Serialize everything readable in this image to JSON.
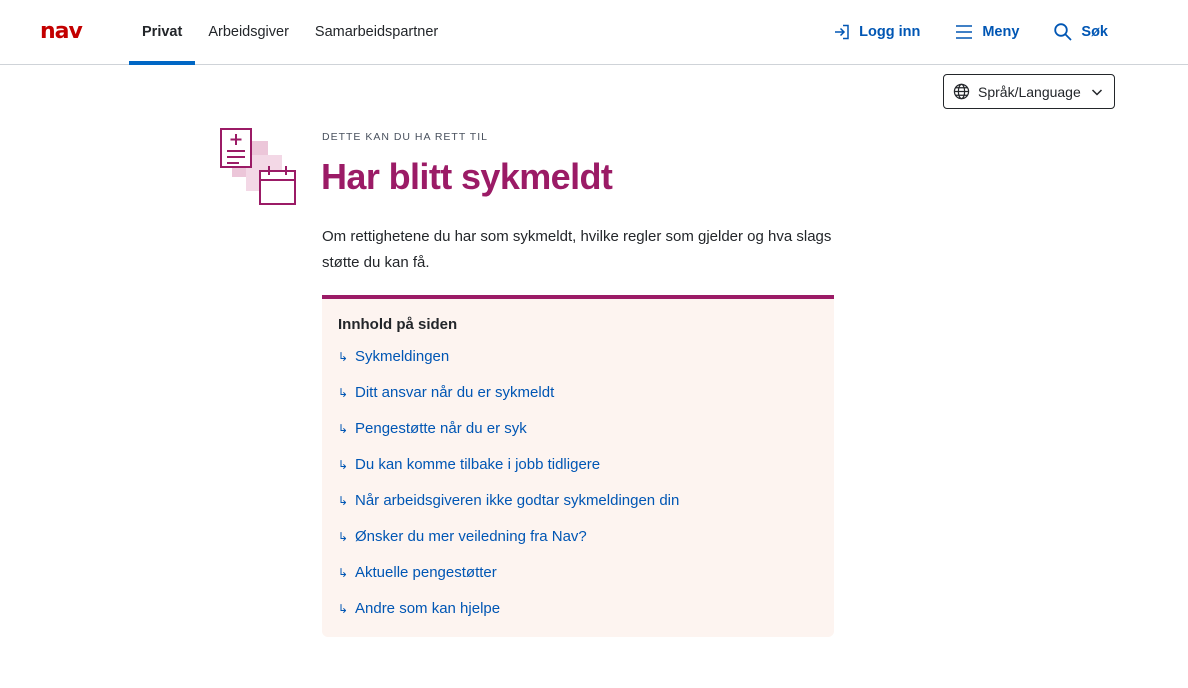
{
  "header": {
    "logo_text": "nav",
    "tabs": [
      {
        "label": "Privat",
        "active": true
      },
      {
        "label": "Arbeidsgiver",
        "active": false
      },
      {
        "label": "Samarbeidspartner",
        "active": false
      }
    ],
    "login_label": "Logg inn",
    "menu_label": "Meny",
    "search_label": "Søk"
  },
  "language": {
    "label": "Språk/Language",
    "icon": "globe-icon"
  },
  "page": {
    "eyebrow": "DETTE KAN DU HA RETT TIL",
    "title": "Har blitt sykmeldt",
    "ingress": "Om rettighetene du har som sykmeldt, hvilke regler som gjelder og hva slags støtte du kan få."
  },
  "toc": {
    "heading": "Innhold på siden",
    "arrow_glyph": "↳",
    "items": [
      {
        "label": "Sykmeldingen"
      },
      {
        "label": "Ditt ansvar når du er sykmeldt"
      },
      {
        "label": "Pengestøtte når du er syk"
      },
      {
        "label": "Du kan komme tilbake i jobb tidligere"
      },
      {
        "label": "Når arbeidsgiveren ikke godtar sykmeldingen din"
      },
      {
        "label": "Ønsker du mer veiledning fra Nav?"
      },
      {
        "label": "Aktuelle pengestøtter"
      },
      {
        "label": "Andre som kan hjelpe"
      }
    ]
  },
  "colors": {
    "logo": "#c30000",
    "link": "#0056b4",
    "accent": "#9b1b66",
    "tab_indicator": "#0067c5",
    "toc_background": "#fdf4f0",
    "illustration_fill": "#ecc6d9"
  }
}
